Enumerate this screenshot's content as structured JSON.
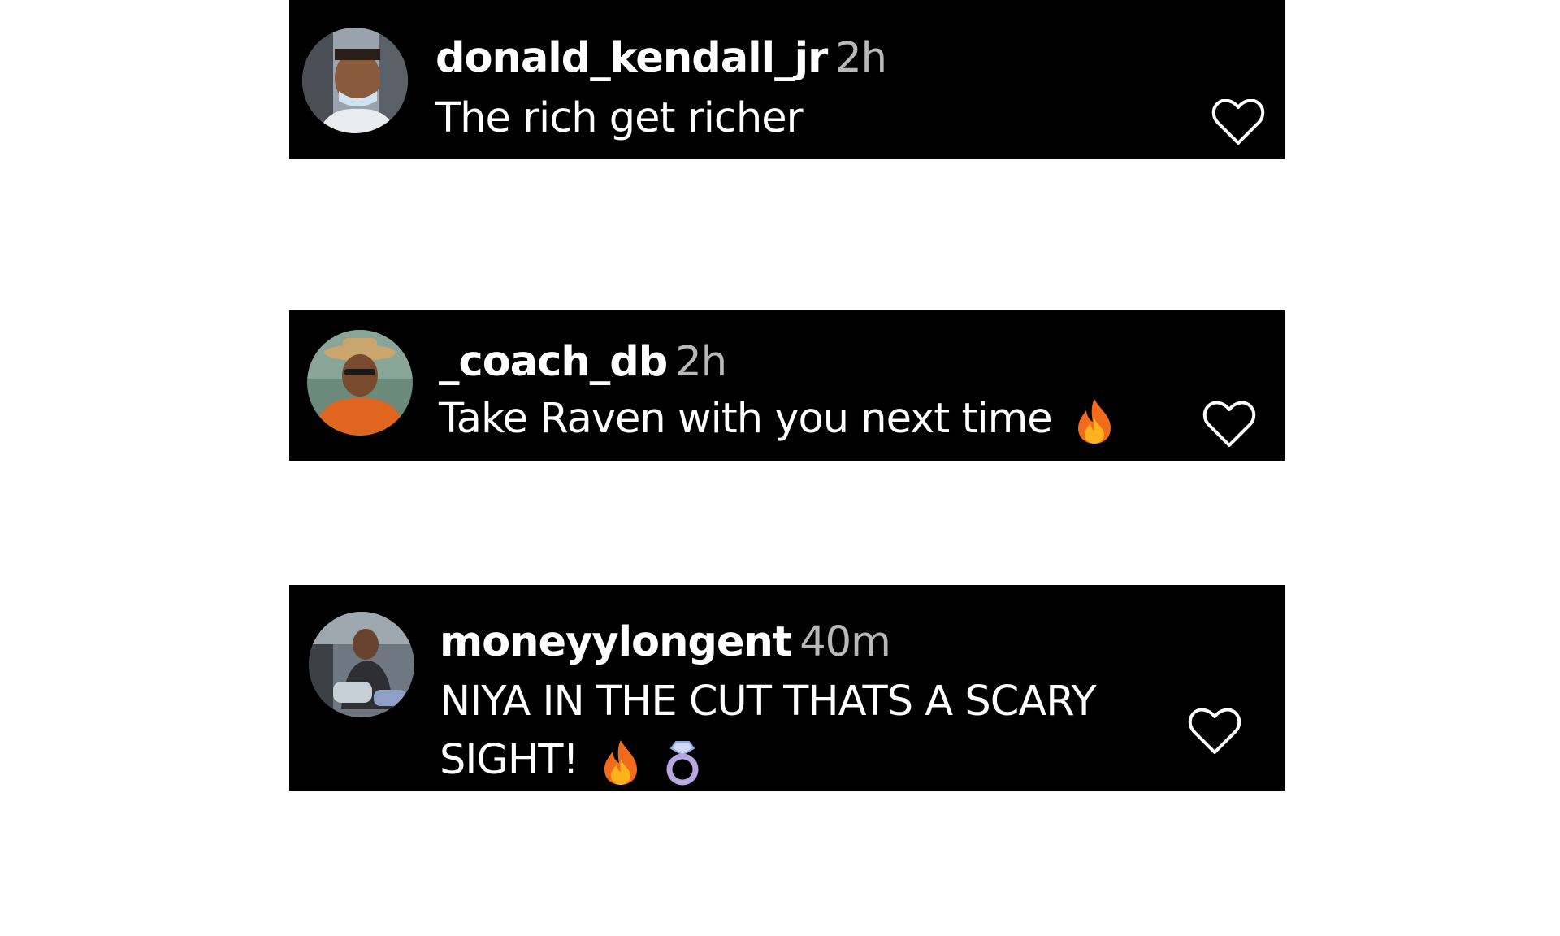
{
  "comments": [
    {
      "username": "donald_kendall_jr",
      "time": "2h",
      "text": "The rich get richer",
      "emojis": []
    },
    {
      "username": "_coach_db",
      "time": "2h",
      "text": "Take Raven with you next time",
      "emojis": [
        "fire"
      ]
    },
    {
      "username": "moneyylongent",
      "time": "40m",
      "text": "NIYA IN THE CUT THATS A SCARY SIGHT!",
      "emojis": [
        "fire",
        "ring"
      ]
    }
  ],
  "icons": {
    "like": "heart-outline-icon",
    "fire": "fire-emoji-icon",
    "ring": "ring-emoji-icon"
  },
  "colors": {
    "background": "#000000",
    "text": "#ffffff",
    "timestamp": "#b9b9b9"
  }
}
